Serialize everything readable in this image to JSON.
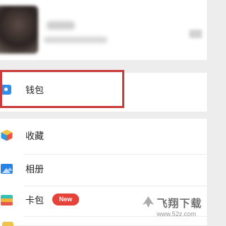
{
  "profile": {
    "avatar_icon": "avatar-blurred",
    "name_blurred": true,
    "qr_icon": "qr-code-icon"
  },
  "menu": {
    "wallet": {
      "label": "钱包",
      "icon": "wallet-icon",
      "highlighted": true,
      "highlight_color": "#cc3b3b"
    },
    "items": [
      {
        "label": "收藏",
        "icon": "favorites-cube-icon"
      },
      {
        "label": "相册",
        "icon": "album-icon"
      },
      {
        "label": "卡包",
        "icon": "card-pack-icon",
        "badge": "New",
        "badge_color": "#e5423a"
      }
    ]
  },
  "watermark": {
    "title": "飞翔下载",
    "url": "www.52z.com"
  },
  "colors": {
    "background": "#ededed",
    "row": "#ffffff",
    "accent_blue": "#2f8fe8"
  }
}
